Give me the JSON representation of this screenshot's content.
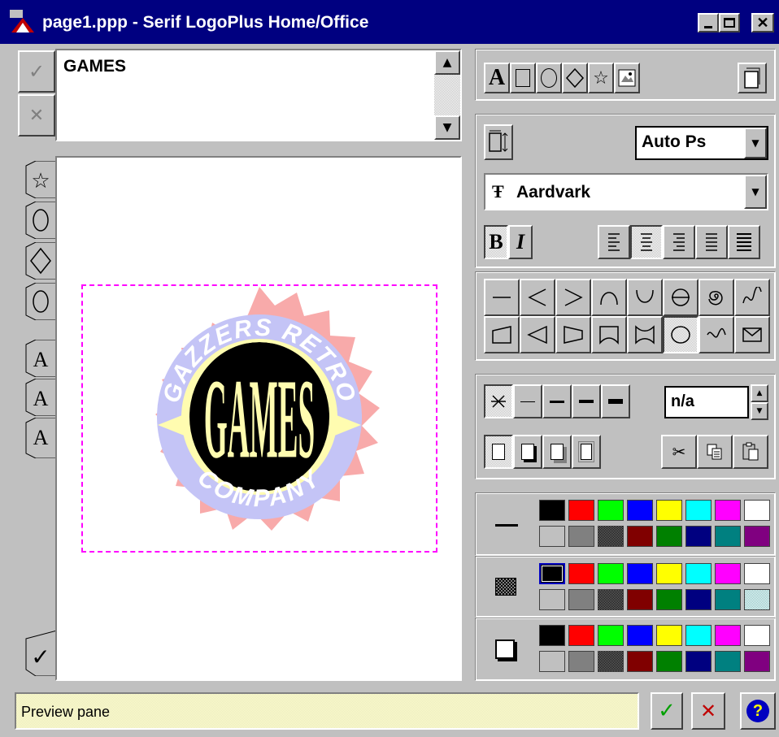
{
  "window": {
    "title": "page1.ppp - Serif LogoPlus Home/Office"
  },
  "editor": {
    "text": "GAMES"
  },
  "toolbar": {
    "font_size": "Auto Ps",
    "font_name": "Aardvark",
    "bold_label": "B",
    "italic_label": "I",
    "line_width_value": "n/a"
  },
  "logo": {
    "top_text": "GAZZERS RETRO",
    "center_text": "GAMES",
    "bottom_text": "COMPANY"
  },
  "palette_colors": [
    "#000000",
    "#ff0000",
    "#00ff00",
    "#0000ff",
    "#ffff00",
    "#00ffff",
    "#ff00ff",
    "#ffffff",
    "#c0c0c0",
    "#808080",
    "#404040",
    "#800000",
    "#008000",
    "#000080",
    "#008080",
    "#800080"
  ],
  "status": {
    "text": "Preview pane"
  }
}
